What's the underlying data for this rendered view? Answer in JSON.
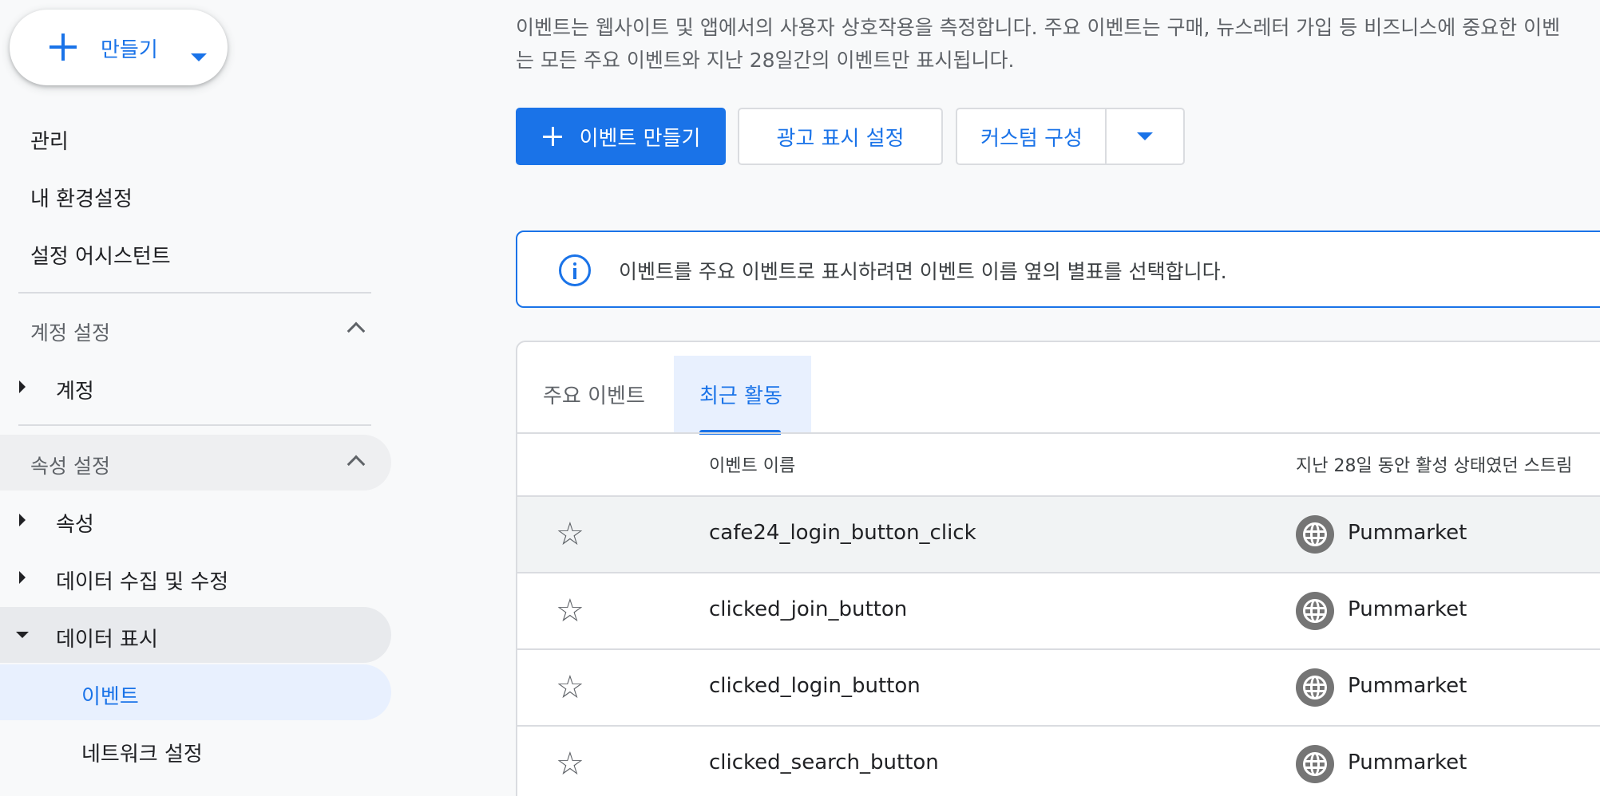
{
  "sidebar": {
    "create_label": "만들기",
    "items": {
      "admin": "관리",
      "preferences": "내 환경설정",
      "setup_assistant": "설정 어시스턴트"
    },
    "account_settings": {
      "label": "계정 설정",
      "children": {
        "account": "계정"
      }
    },
    "property_settings": {
      "label": "속성 설정",
      "children": {
        "property": "속성",
        "data_collection": "데이터 수집 및 수정",
        "data_display": "데이터 표시"
      },
      "data_display_children": {
        "events": "이벤트",
        "network_settings": "네트워크 설정"
      }
    }
  },
  "main": {
    "description_line1": "이벤트는 웹사이트 및 앱에서의 사용자 상호작용을 측정합니다. 주요 이벤트는 구매, 뉴스레터 가입 등 비즈니스에 중요한 이벤",
    "description_line2": "는 모든 주요 이벤트와 지난 28일간의 이벤트만 표시됩니다.",
    "buttons": {
      "create_event": "이벤트 만들기",
      "ad_display_settings": "광고 표시 설정",
      "custom_config": "커스텀 구성"
    },
    "info_banner": "이벤트를 주요 이벤트로 표시하려면 이벤트 이름 옆의 별표를 선택합니다.",
    "tabs": {
      "major_events": "주요 이벤트",
      "recent_activity": "최근 활동"
    },
    "table": {
      "headers": {
        "event_name": "이벤트 이름",
        "streams": "지난 28일 동안 활성 상태였던 스트림"
      },
      "rows": [
        {
          "name": "cafe24_login_button_click",
          "stream": "Pummarket"
        },
        {
          "name": "clicked_join_button",
          "stream": "Pummarket"
        },
        {
          "name": "clicked_login_button",
          "stream": "Pummarket"
        },
        {
          "name": "clicked_search_button",
          "stream": "Pummarket"
        }
      ]
    }
  },
  "colors": {
    "accent": "#1a73e8",
    "selected_bg": "#e8f0fe",
    "hover_bg": "#e8eaed",
    "icon_gray": "#757575"
  }
}
